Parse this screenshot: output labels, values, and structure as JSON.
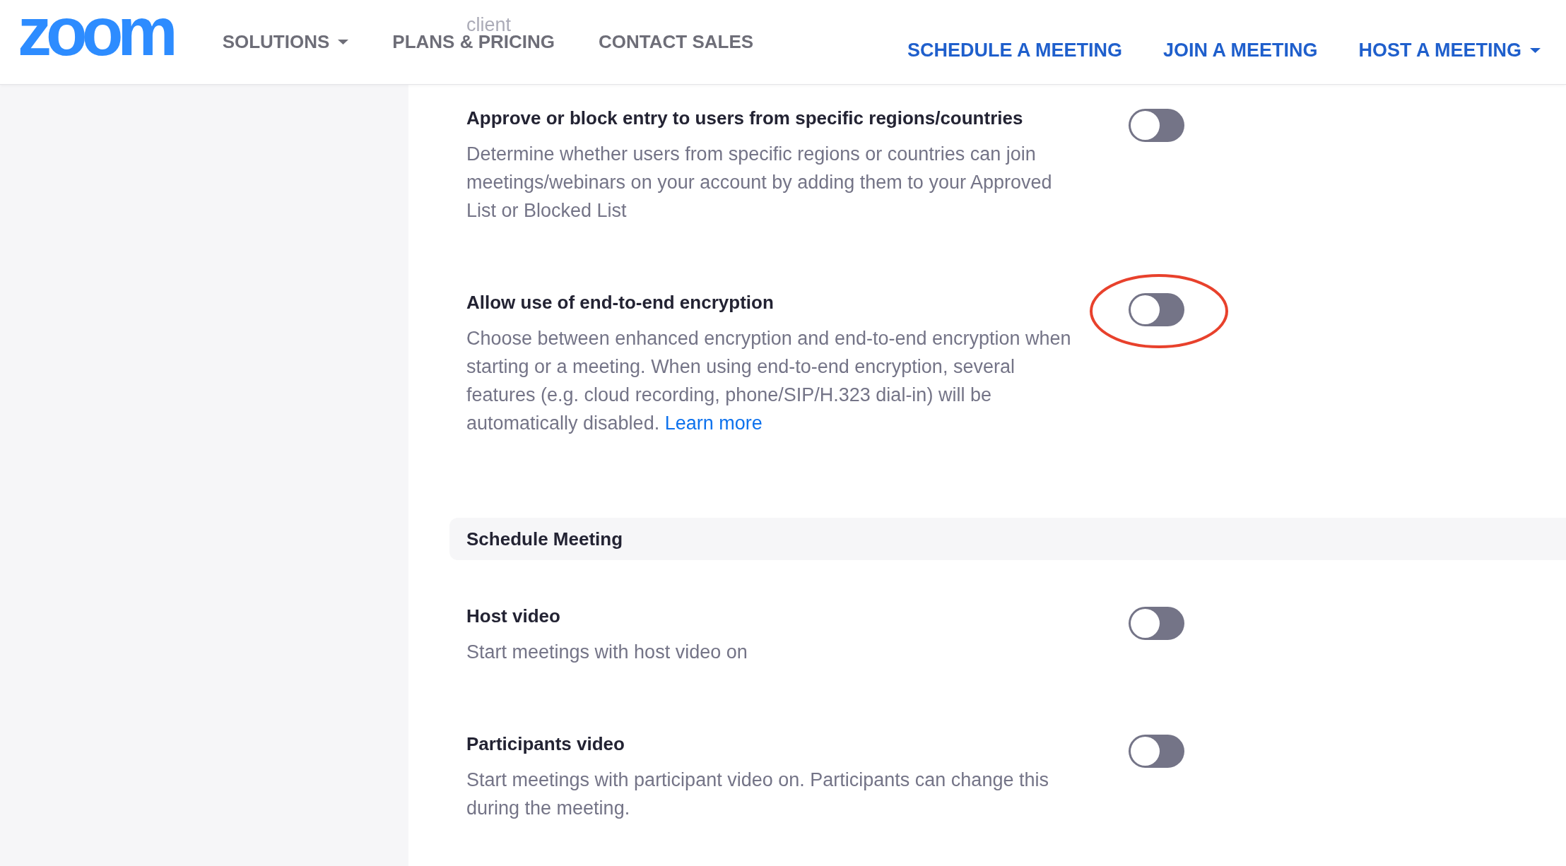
{
  "header": {
    "logo": "zoom",
    "nav_left": [
      {
        "label": "SOLUTIONS",
        "dropdown": true
      },
      {
        "label": "PLANS & PRICING",
        "dropdown": false
      },
      {
        "label": "CONTACT SALES",
        "dropdown": false
      }
    ],
    "nav_right": [
      {
        "label": "SCHEDULE A MEETING",
        "dropdown": false
      },
      {
        "label": "JOIN A MEETING",
        "dropdown": false
      },
      {
        "label": "HOST A MEETING",
        "dropdown": true
      }
    ]
  },
  "content": [
    {
      "kind": "fragment",
      "text": "client"
    },
    {
      "kind": "setting",
      "title": "Approve or block entry to users from specific regions/countries",
      "description": "Determine whether users from specific regions or countries can join meetings/webinars on your account by adding them to your Approved List or Blocked List",
      "on": false,
      "highlighted": false
    },
    {
      "kind": "setting",
      "title": "Allow use of end-to-end encryption",
      "description": "Choose between enhanced encryption and end-to-end encryption when starting or a meeting. When using end-to-end encryption, several features (e.g. cloud recording, phone/SIP/H.323 dial-in) will be automatically disabled.",
      "link": "Learn more",
      "on": false,
      "highlighted": true
    },
    {
      "kind": "section",
      "title": "Schedule Meeting"
    },
    {
      "kind": "setting",
      "title": "Host video",
      "description": "Start meetings with host video on",
      "on": false,
      "highlighted": false
    },
    {
      "kind": "setting",
      "title": "Participants video",
      "description": "Start meetings with participant video on. Participants can change this during the meeting.",
      "on": false,
      "highlighted": false
    }
  ]
}
